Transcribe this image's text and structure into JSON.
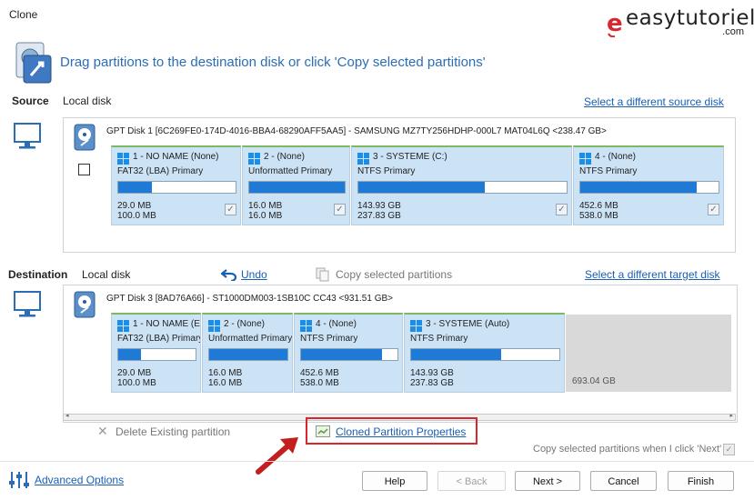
{
  "window": {
    "title": "Clone"
  },
  "brand": {
    "name": "easytutoriel",
    "suffix": ".com",
    "colors": {
      "accent": "#d7282f"
    }
  },
  "header": {
    "instruction": "Drag partitions to the destination disk or click 'Copy selected partitions'"
  },
  "source": {
    "section_label": "Source",
    "disk_kind": "Local disk",
    "select_link": "Select a different source disk",
    "disk_header": "GPT Disk 1 [6C269FE0-174D-4016-BBA4-68290AFF5AA5] - SAMSUNG MZ7TY256HDHP-000L7 MAT04L6Q  <238.47 GB>",
    "partitions": [
      {
        "title": "1 - NO NAME (None)",
        "type": "FAT32 (LBA) Primary",
        "used": "29.0 MB",
        "total": "100.0 MB",
        "fill": 0.29,
        "checked": true
      },
      {
        "title": "2 -  (None)",
        "type": "Unformatted Primary",
        "used": "16.0 MB",
        "total": "16.0 MB",
        "fill": 1.0,
        "checked": true
      },
      {
        "title": "3 - SYSTEME (C:)",
        "type": "NTFS Primary",
        "used": "143.93 GB",
        "total": "237.83 GB",
        "fill": 0.605,
        "checked": true
      },
      {
        "title": "4 -  (None)",
        "type": "NTFS Primary",
        "used": "452.6 MB",
        "total": "538.0 MB",
        "fill": 0.84,
        "checked": true
      }
    ]
  },
  "destination": {
    "section_label": "Destination",
    "disk_kind": "Local disk",
    "undo_label": "Undo",
    "copy_label": "Copy selected partitions",
    "select_link": "Select a different target disk",
    "disk_header": "GPT Disk 3 [8AD76A66] - ST1000DM003-1SB10C CC43  <931.51 GB>",
    "partitions": [
      {
        "title": "1 - NO NAME (E",
        "type": "FAT32 (LBA) Primary",
        "used": "29.0 MB",
        "total": "100.0 MB",
        "fill": 0.29
      },
      {
        "title": "2 -  (None)",
        "type": "Unformatted Primary",
        "used": "16.0 MB",
        "total": "16.0 MB",
        "fill": 1.0
      },
      {
        "title": "4 -  (None)",
        "type": "NTFS Primary",
        "used": "452.6 MB",
        "total": "538.0 MB",
        "fill": 0.84
      },
      {
        "title": "3 - SYSTEME (Auto)",
        "type": "NTFS Primary",
        "used": "143.93 GB",
        "total": "237.83 GB",
        "fill": 0.605
      }
    ],
    "unallocated": "693.04 GB"
  },
  "actions": {
    "delete_partition": "Delete Existing partition",
    "cloned_properties": "Cloned Partition Properties",
    "copy_on_next": "Copy selected partitions when I click 'Next'",
    "highlight_color": "#d7282f"
  },
  "footer": {
    "advanced": "Advanced Options",
    "help": "Help",
    "back": "< Back",
    "next": "Next >",
    "cancel": "Cancel",
    "finish": "Finish"
  }
}
